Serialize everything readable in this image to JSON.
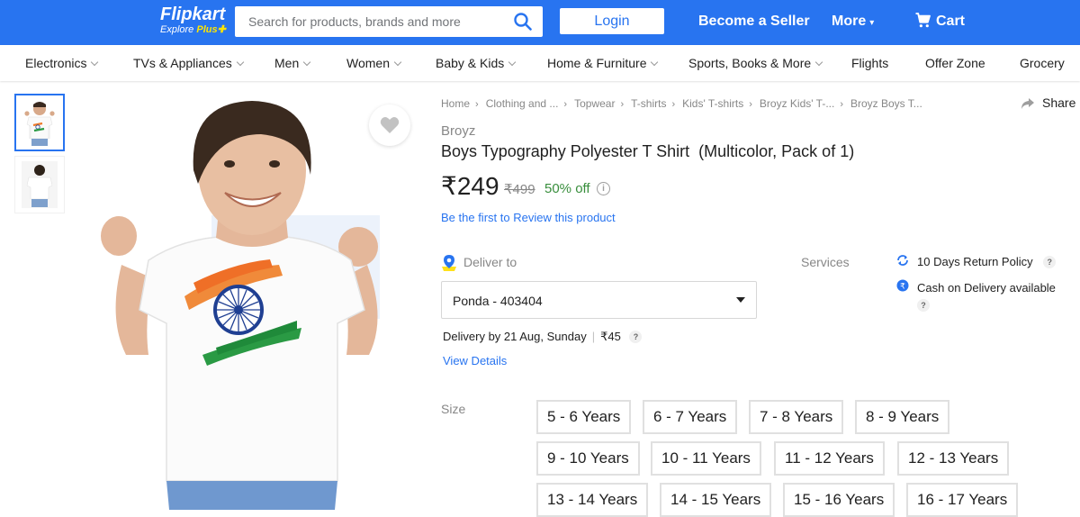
{
  "header": {
    "logo": "Flipkart",
    "logo_sub": "Explore",
    "logo_plus": "Plus",
    "search_placeholder": "Search for products, brands and more",
    "login": "Login",
    "become_seller": "Become a Seller",
    "more": "More",
    "cart": "Cart",
    "brand_color": "#2874f0"
  },
  "categories": [
    {
      "label": "Electronics",
      "has_menu": true
    },
    {
      "label": "TVs & Appliances",
      "has_menu": true
    },
    {
      "label": "Men",
      "has_menu": true
    },
    {
      "label": "Women",
      "has_menu": true
    },
    {
      "label": "Baby & Kids",
      "has_menu": true
    },
    {
      "label": "Home & Furniture",
      "has_menu": true
    },
    {
      "label": "Sports, Books & More",
      "has_menu": true
    },
    {
      "label": "Flights",
      "has_menu": false
    },
    {
      "label": "Offer Zone",
      "has_menu": false
    },
    {
      "label": "Grocery",
      "has_menu": false
    }
  ],
  "breadcrumbs": [
    "Home",
    "Clothing and ...",
    "Topwear",
    "T-shirts",
    "Kids' T-shirts",
    "Broyz Kids' T-...",
    "Broyz Boys T..."
  ],
  "share": "Share",
  "product": {
    "brand": "Broyz",
    "title": "Boys Typography Polyester T Shirt  (Multicolor, Pack of 1)",
    "price": "₹249",
    "mrp": "₹499",
    "discount": "50% off",
    "review_link": "Be the first to Review this product"
  },
  "delivery": {
    "label": "Deliver to",
    "pincode": "Ponda - 403404",
    "date_text": "Delivery by 21 Aug, Sunday",
    "charge": "₹45",
    "view_details": "View Details"
  },
  "services": {
    "label": "Services",
    "items": [
      "10 Days Return Policy",
      "Cash on Delivery available"
    ]
  },
  "size": {
    "label": "Size",
    "options": [
      "5 - 6 Years",
      "6 - 7 Years",
      "7 - 8 Years",
      "8 - 9 Years",
      "9 - 10 Years",
      "10 - 11 Years",
      "11 - 12 Years",
      "12 - 13 Years",
      "13 - 14 Years",
      "14 - 15 Years",
      "15 - 16 Years",
      "16 - 17 Years"
    ]
  }
}
